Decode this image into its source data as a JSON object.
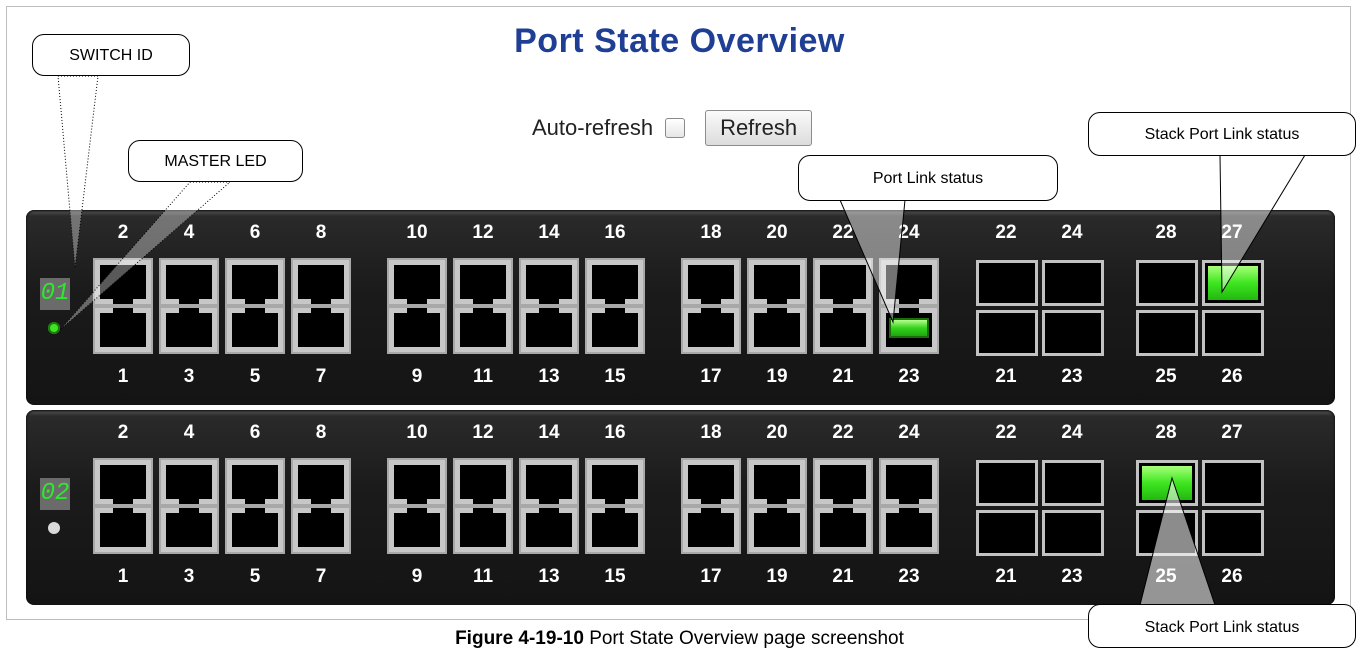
{
  "title": "Port State Overview",
  "auto_refresh_label": "Auto-refresh",
  "refresh_button": "Refresh",
  "callouts": {
    "switch_id": "SWITCH ID",
    "master_led": "MASTER LED",
    "port_link_status": "Port Link status",
    "stack_port_link_status": "Stack Port Link status"
  },
  "caption": {
    "figure": "Figure 4-19-10",
    "text": "Port State Overview page screenshot"
  },
  "colors": {
    "title": "#1f3f95",
    "link_up": "#3ee620",
    "master_on": "#3ee620",
    "master_off": "#d9d9d9"
  },
  "units": [
    {
      "id": "01",
      "master": true,
      "rj45_top_labels": [
        "2",
        "4",
        "6",
        "8",
        "10",
        "12",
        "14",
        "16",
        "18",
        "20",
        "22",
        "24"
      ],
      "rj45_bottom_labels": [
        "1",
        "3",
        "5",
        "7",
        "9",
        "11",
        "13",
        "15",
        "17",
        "19",
        "21",
        "23"
      ],
      "sfp_top_labels": [
        "22",
        "24"
      ],
      "sfp_bottom_labels": [
        "21",
        "23"
      ],
      "stack_top_labels": [
        "28",
        "27"
      ],
      "stack_bottom_labels": [
        "25",
        "26"
      ],
      "rj45_link_up": [
        "23"
      ],
      "sfp_link_up": [],
      "stack_link_up": [
        "27"
      ]
    },
    {
      "id": "02",
      "master": false,
      "rj45_top_labels": [
        "2",
        "4",
        "6",
        "8",
        "10",
        "12",
        "14",
        "16",
        "18",
        "20",
        "22",
        "24"
      ],
      "rj45_bottom_labels": [
        "1",
        "3",
        "5",
        "7",
        "9",
        "11",
        "13",
        "15",
        "17",
        "19",
        "21",
        "23"
      ],
      "sfp_top_labels": [
        "22",
        "24"
      ],
      "sfp_bottom_labels": [
        "21",
        "23"
      ],
      "stack_top_labels": [
        "28",
        "27"
      ],
      "stack_bottom_labels": [
        "25",
        "26"
      ],
      "rj45_link_up": [],
      "sfp_link_up": [],
      "stack_link_up": [
        "28"
      ]
    }
  ]
}
